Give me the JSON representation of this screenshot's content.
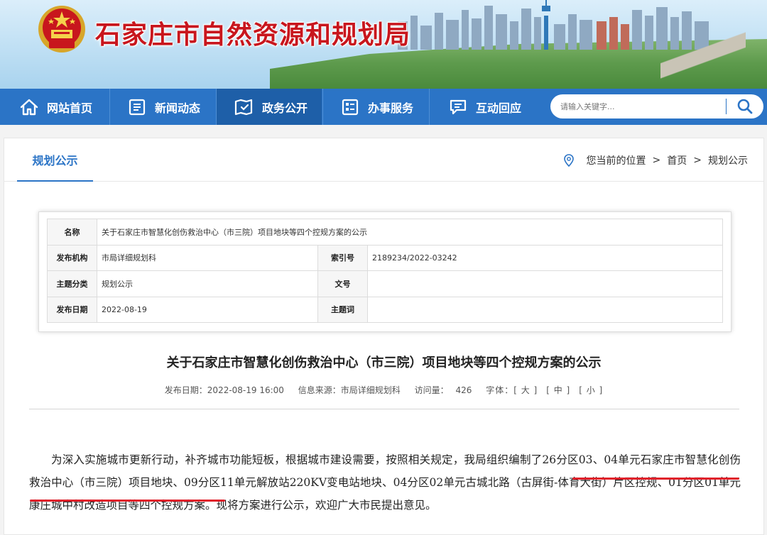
{
  "header": {
    "site_title": "石家庄市自然资源和规划局"
  },
  "nav": {
    "items": [
      {
        "label": "网站首页",
        "icon": "home-icon"
      },
      {
        "label": "新闻动态",
        "icon": "news-icon"
      },
      {
        "label": "政务公开",
        "icon": "government-affairs-icon"
      },
      {
        "label": "办事服务",
        "icon": "service-list-icon"
      },
      {
        "label": "互动回应",
        "icon": "chat-icon"
      }
    ],
    "active_index": 2,
    "search_placeholder": "请输入关键字..."
  },
  "section": {
    "title": "规划公示",
    "breadcrumb_prefix": "您当前的位置",
    "breadcrumb": [
      "首页",
      "规划公示"
    ]
  },
  "meta_table": {
    "name_label": "名称",
    "name_value": "关于石家庄市智慧化创伤救治中心（市三院）项目地块等四个控规方案的公示",
    "org_label": "发布机构",
    "org_value": "市局详细规划科",
    "index_label": "索引号",
    "index_value": "2189234/2022-03242",
    "category_label": "主题分类",
    "category_value": "规划公示",
    "doc_label": "文号",
    "doc_value": "",
    "date_label": "发布日期",
    "date_value": "2022-08-19",
    "keyword_label": "主题词",
    "keyword_value": ""
  },
  "article": {
    "title": "关于石家庄市智慧化创伤救治中心（市三院）项目地块等四个控规方案的公示",
    "publish_label": "发布日期：2022-08-19 16:00",
    "source_label": "信息来源：市局详细规划科",
    "views_label": "访问量：",
    "views": "426",
    "font_label": "字体：",
    "font_large": "[ 大 ]",
    "font_medium": "[ 中 ]",
    "font_small": "[ 小 ]",
    "body": "为深入实施城市更新行动，补齐城市功能短板，根据城市建设需要，按照相关规定，我局组织编制了26分区03、04单元石家庄市智慧化创伤救治中心（市三院）项目地块、09分区11单元解放站220KV变电站地块、04分区02单元古城北路（古屏街-体育大街）片区控规、01分区01单元康庄城中村改造项目等四个控规方案。现将方案进行公示，欢迎广大市民提出意见。"
  },
  "colors": {
    "nav_bg": "#2b74c6",
    "nav_active": "#1e5fa8",
    "title_red": "#c8161d",
    "underline_red": "#e01f2a"
  }
}
